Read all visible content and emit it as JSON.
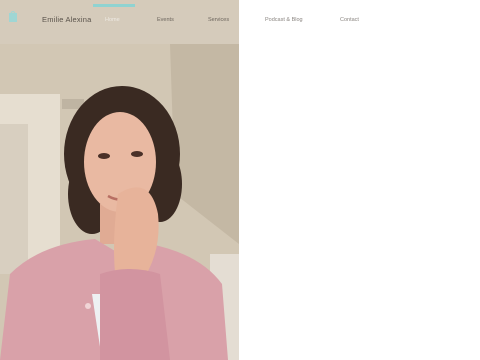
{
  "header": {
    "site_name": "Emilie Alexina",
    "logo_icon": "bag-logo-icon",
    "accent_color": "#8fd3d1"
  },
  "nav": {
    "items": [
      {
        "label": "Home",
        "active": true
      },
      {
        "label": "Events",
        "active": false
      },
      {
        "label": "Services",
        "active": false
      },
      {
        "label": "Podcast & Blog",
        "active": false
      },
      {
        "label": "Contact",
        "active": false
      }
    ]
  },
  "hero": {
    "image_subject": "portrait-photo"
  }
}
